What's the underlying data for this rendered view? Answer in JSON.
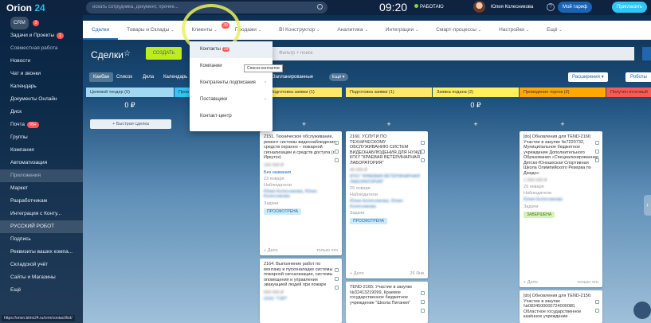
{
  "topbar": {
    "logo_main": "Orion",
    "logo_num": "24",
    "search_placeholder": "искать сотрудника, документ, прочее...",
    "time": "09:20",
    "work_status": "РАБОТАЮ",
    "user_name": "Юлия Колесникова",
    "tariff_label": "Мой тариф",
    "invite_label": "Пригласить"
  },
  "sidebar": {
    "items": [
      {
        "label": "CRM",
        "badge": "3"
      },
      {
        "label": "Задачи и Проекты",
        "badge": "1"
      },
      {
        "label": "Совместная работа"
      },
      {
        "label": "Новости"
      },
      {
        "label": "Чат и звонки"
      },
      {
        "label": "Календарь"
      },
      {
        "label": "Документы Онлайн"
      },
      {
        "label": "Диск"
      },
      {
        "label": "Почта",
        "badge": "99+"
      },
      {
        "label": "Группы"
      },
      {
        "label": "Компания"
      },
      {
        "label": "Автоматизация"
      },
      {
        "label": "Приложения"
      },
      {
        "label": "Маркет"
      },
      {
        "label": "Разработчикам"
      },
      {
        "label": "Интеграция с Конту..."
      },
      {
        "label": "РУССКИЙ РОБОТ"
      },
      {
        "label": "Подпись"
      },
      {
        "label": "Реквизиты ваших компа..."
      },
      {
        "label": "Складской учёт"
      },
      {
        "label": "Сайты и Магазины"
      },
      {
        "label": "Ещё"
      }
    ],
    "status_url": "https://orion.bitrix24.ru/crm/contact/list/"
  },
  "nav": {
    "items": [
      "Сделки",
      "Товары и Склады",
      "Клиенты",
      "Продажи",
      "BI Конструктор",
      "Аналитика",
      "Интеграции",
      "Смарт-процессы",
      "Настройки",
      "Ещё"
    ],
    "clients_badge": "39"
  },
  "dropdown": {
    "items": [
      "Контакты",
      "Компании",
      "Контрагенты подписания",
      "Поставщики",
      "Контакт-центр"
    ],
    "contacts_badge": "39",
    "tooltip": "Список контактов"
  },
  "page": {
    "title": "Сделки",
    "create_label": "СОЗДАТЬ",
    "filter_placeholder": "Фильтр + поиск"
  },
  "viewbar": {
    "tabs": [
      "Канбан",
      "Список",
      "Дела",
      "Календарь"
    ],
    "planned": "Запланированные",
    "more": "Ещё",
    "extensions": "Расширения",
    "robots": "Роботы"
  },
  "columns": [
    {
      "name": "Целевой тендер",
      "count": "0",
      "sum": "0 ₽",
      "color": "#a2d9f2"
    },
    {
      "name": "Пров",
      "count": "",
      "sum": "",
      "color": "#2fc6f6"
    },
    {
      "name": "Подготовка заявки",
      "count": "1",
      "sum": "",
      "color": "#ffe867"
    },
    {
      "name": "Подготовка заявки",
      "count": "1",
      "sum": "",
      "color": "#ffe867"
    },
    {
      "name": "Заявка подана",
      "count": "2",
      "sum": "0 ₽",
      "color": "#fff05c"
    },
    {
      "name": "Проведение торгов",
      "count": "2",
      "sum": "",
      "color": "#ffa900"
    },
    {
      "name": "Получен итоговый",
      "count": "",
      "sum": "",
      "color": "#ff5752"
    }
  ],
  "quick_deal": "+ Быстрая сделка",
  "cards": [
    {
      "title": "2151. Техническое обслуживание, ремонт системы видеонаблюдения, средств охранно – пожарной сигнализации и средств доступа (г. Иркутск)",
      "sum": "100 000 ₽",
      "company": "Без названия",
      "date": "23 января",
      "observers_label": "Наблюдатели",
      "observers": "Юлия Колесникова, Юлия Колесникова",
      "task_label": "Задачи",
      "status": "ПРОСМОТРЕНА",
      "footer_left": "+ Дело",
      "footer_right": "только что"
    },
    {
      "title": "2160. УСЛУГИ ПО ТЕХНИЧЕСКОМУ ОБСЛУЖИВАНИЮ СИСТЕМ ВИДЕОНАБЛЮДЕНИЯ ДЛЯ НУЖД КГКУ \"КРАЕВАЯ ВЕТЕРИНАРНАЯ ЛАБОРАТОРИЯ\"",
      "sum": "40 000 ₽",
      "company": "КГКУ \"КРАЕВАЯ ВЕТЕРИНАРНАЯ ЛАБОРАТОРИЯ\"",
      "date": "29 января",
      "observers_label": "Наблюдатели",
      "observers": "Юлия Колесникова, Юлия Колесникова",
      "task_label": "Задачи",
      "status": "ПРОСМОТРЕНА",
      "footer_left": "+ Дело",
      "footer_right": "26 Янв"
    },
    {
      "title": "[do] Обновления для TEND-2166: Участие в закупке №7220732, Муниципальное бюджетное учреждение Дополнительного Образования «Специализированная Детско-Юношеская Спортивная Школа Олимпийского Резерва по Дзюдо»",
      "sum": "1 000 000 ₽",
      "date": "29 января",
      "observers_label": "Наблюдатели",
      "observers": "Юлия Колесникова",
      "task_label": "Задачи",
      "status": "ЗАВЕРШЕНА",
      "footer_left": "+ Дело",
      "footer_right": "только что"
    },
    {
      "title": "2164. Выполнение работ по монтажу и пусконаладке системы пожарной сигнализации, системы оповещения и управления эвакуацией людей при пожаре",
      "sum": "500 000 ₽",
      "company": "ООО \"ТЭП\"",
      "footer_left": "",
      "footer_right": ""
    },
    {
      "title": "TEND-2165: Участие в закупке №32413219099, Краевое государственное бюджетное учреждение \"Школа Питания\"",
      "footer_left": "",
      "footer_right": ""
    },
    {
      "title": "[do] Обновления для TEND-2156: Участие в закупке №0834500000724000080, Областное государственное казённое учреждение",
      "footer_left": "",
      "footer_right": ""
    }
  ]
}
